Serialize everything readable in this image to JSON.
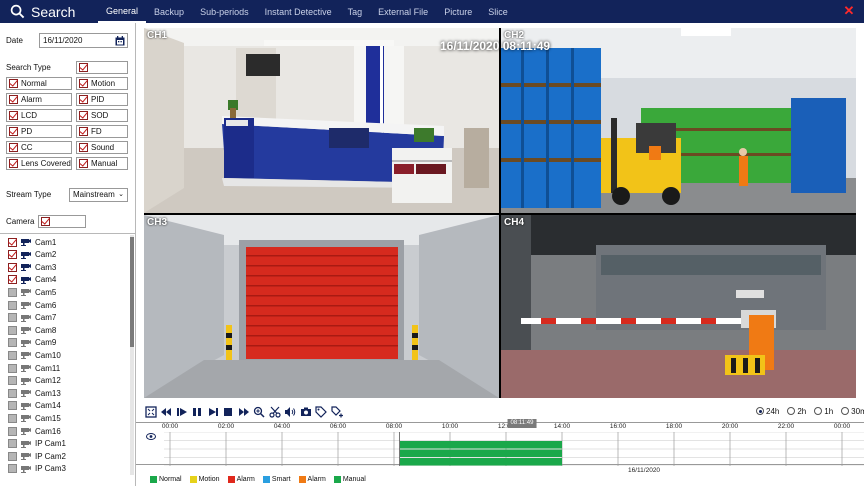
{
  "app": {
    "title": "Search"
  },
  "tabs": [
    "General",
    "Backup",
    "Sub-periods",
    "Instant Detective",
    "Tag",
    "External File",
    "Picture",
    "Slice"
  ],
  "left": {
    "date_label": "Date",
    "date_value": "16/11/2020",
    "search_type_label": "Search Type",
    "search_types": [
      {
        "label": "Normal",
        "checked": true
      },
      {
        "label": "Motion",
        "checked": true
      },
      {
        "label": "Alarm",
        "checked": true
      },
      {
        "label": "PID",
        "checked": true
      },
      {
        "label": "LCD",
        "checked": true
      },
      {
        "label": "SOD",
        "checked": true
      },
      {
        "label": "PD",
        "checked": true
      },
      {
        "label": "FD",
        "checked": true
      },
      {
        "label": "CC",
        "checked": true
      },
      {
        "label": "Sound",
        "checked": true
      },
      {
        "label": "Lens Covered",
        "checked": true
      },
      {
        "label": "Manual",
        "checked": true
      }
    ],
    "stream_type_label": "Stream Type",
    "stream_type_value": "Mainstream",
    "camera_label": "Camera",
    "cameras": [
      {
        "label": "Cam1",
        "checked": true
      },
      {
        "label": "Cam2",
        "checked": true
      },
      {
        "label": "Cam3",
        "checked": true
      },
      {
        "label": "Cam4",
        "checked": true
      },
      {
        "label": "Cam5",
        "checked": false
      },
      {
        "label": "Cam6",
        "checked": false
      },
      {
        "label": "Cam7",
        "checked": false
      },
      {
        "label": "Cam8",
        "checked": false
      },
      {
        "label": "Cam9",
        "checked": false
      },
      {
        "label": "Cam10",
        "checked": false
      },
      {
        "label": "Cam11",
        "checked": false
      },
      {
        "label": "Cam12",
        "checked": false
      },
      {
        "label": "Cam13",
        "checked": false
      },
      {
        "label": "Cam14",
        "checked": false
      },
      {
        "label": "Cam15",
        "checked": false
      },
      {
        "label": "Cam16",
        "checked": false
      },
      {
        "label": "IP Cam1",
        "checked": false
      },
      {
        "label": "IP Cam2",
        "checked": false
      },
      {
        "label": "IP Cam3",
        "checked": false
      }
    ]
  },
  "video": {
    "channels": [
      "CH1",
      "CH2",
      "CH3",
      "CH4"
    ],
    "timestamp": "16/11/2020 08:11:49"
  },
  "playback": {
    "zoom_options": [
      {
        "label": "24h",
        "selected": true
      },
      {
        "label": "2h",
        "selected": false
      },
      {
        "label": "1h",
        "selected": false
      },
      {
        "label": "30m",
        "selected": false
      }
    ],
    "tick_labels": [
      "00:00",
      "02:00",
      "04:00",
      "06:00",
      "08:00",
      "10:00",
      "12:00",
      "14:00",
      "16:00",
      "18:00",
      "20:00",
      "22:00",
      "00:00"
    ],
    "current_time": "08:11:49",
    "date": "16/11/2020",
    "recording": {
      "start_hour": 8.2,
      "end_hour": 14.0,
      "rows": 3,
      "type": "Manual"
    },
    "legend": [
      {
        "label": "Normal",
        "color": "#1aa84a"
      },
      {
        "label": "Motion",
        "color": "#e6d21a"
      },
      {
        "label": "Alarm",
        "color": "#e0281c"
      },
      {
        "label": "Smart",
        "color": "#2a9fe0"
      },
      {
        "label": "Alarm",
        "color": "#f07a14"
      },
      {
        "label": "Manual",
        "color": "#1aa84a"
      }
    ]
  },
  "colors": {
    "header": "#12235a",
    "accent_check": "#c01818",
    "recording": "#1aa84a"
  }
}
